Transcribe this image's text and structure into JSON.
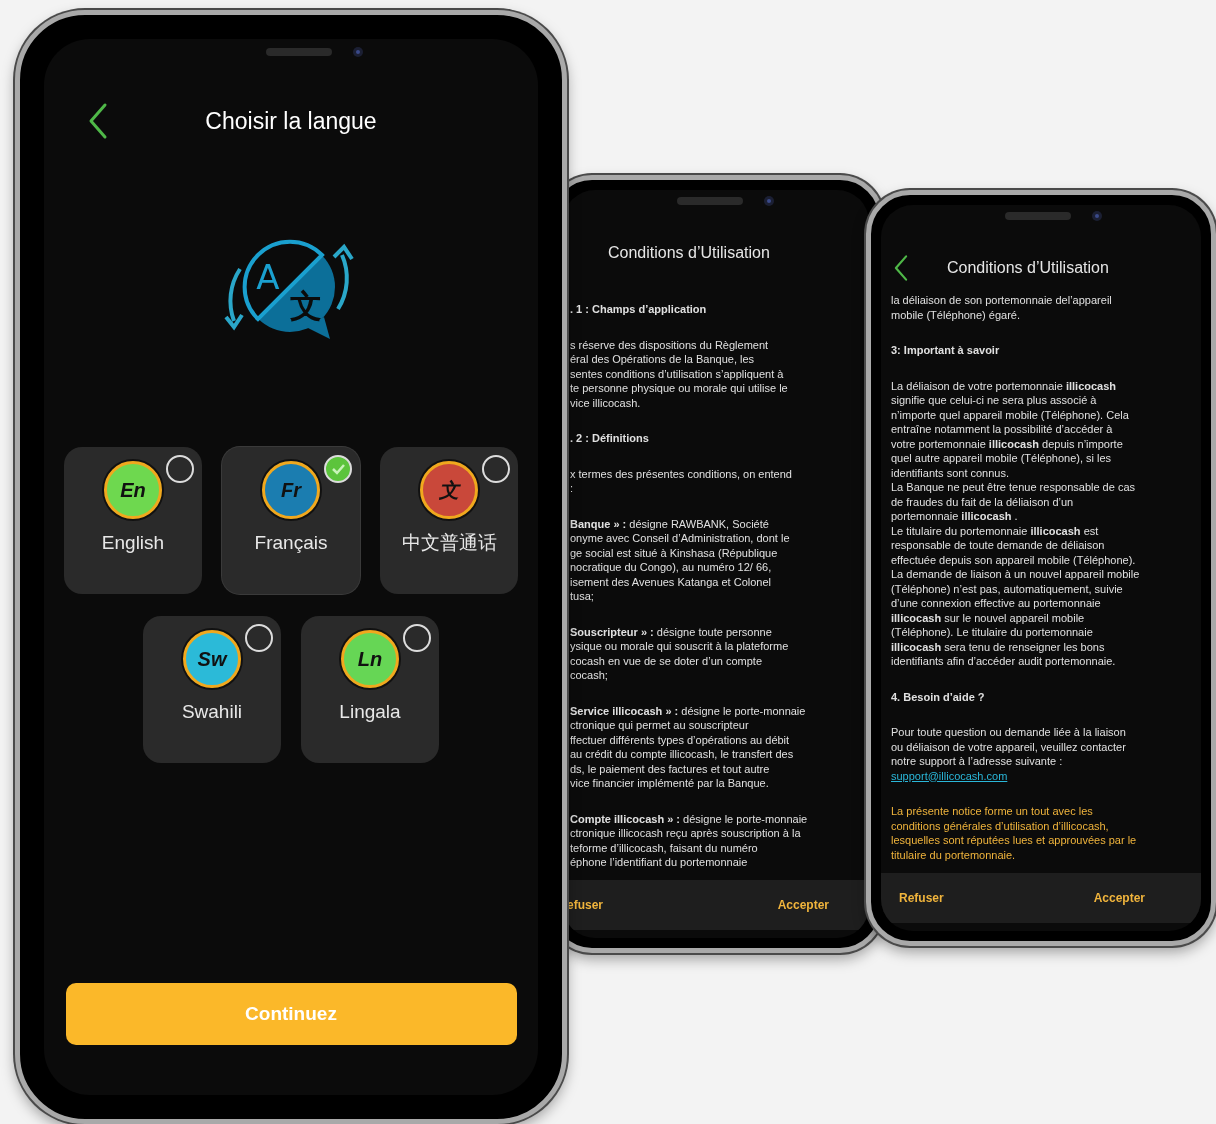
{
  "phones": [
    {
      "kind": "language_picker",
      "title": "Choisir la langue",
      "back_button": true,
      "icon_glyphs": [
        "A",
        "文"
      ],
      "languages": [
        {
          "badge": "En",
          "label": "English",
          "color": "#6ed84f",
          "selected": false
        },
        {
          "badge": "Fr",
          "label": "Français",
          "color": "#1b7db0",
          "selected": true
        },
        {
          "badge": "文",
          "label": "中文普通话",
          "color": "#c9483a",
          "selected": false
        },
        {
          "badge": "Sw",
          "label": "Swahili",
          "color": "#2bbad8",
          "selected": false
        },
        {
          "badge": "Ln",
          "label": "Lingala",
          "color": "#66d655",
          "selected": false
        }
      ],
      "continue_button": "Continuez"
    },
    {
      "kind": "terms",
      "title": "Conditions d’Utilisation",
      "back_button": false,
      "blocks": [
        {
          "kind": "heading",
          "lines": [
            ". 1 : Champs d’application"
          ]
        },
        {
          "kind": "paragraph",
          "lines": [
            "s réserve des dispositions du Règlement",
            "éral des Opérations de la Banque, les",
            "sentes conditions d’utilisation s’appliquent à",
            "te personne physique ou morale qui utilise le",
            "vice illicocash."
          ]
        },
        {
          "kind": "heading",
          "lines": [
            ". 2 : Définitions"
          ]
        },
        {
          "kind": "paragraph",
          "lines": [
            "x termes des présentes conditions, on entend",
            ":"
          ]
        },
        {
          "kind": "paragraph",
          "lines": [
            "**Banque » :** désigne RAWBANK, Société",
            "onyme avec Conseil d’Administration, dont le",
            "ge social est situé à Kinshasa (République",
            "nocratique du Congo), au numéro 12/ 66,",
            "isement des Avenues Katanga et Colonel",
            "tusa;"
          ]
        },
        {
          "kind": "paragraph",
          "lines": [
            "**Souscripteur » :** désigne toute personne",
            "ysique ou morale qui souscrit à la plateforme",
            "cocash en vue de se doter d’un compte",
            "cocash;"
          ]
        },
        {
          "kind": "paragraph",
          "lines": [
            "**Service illicocash » :** désigne le porte-monnaie",
            "ctronique qui permet au souscripteur",
            "ffectuer différents types d’opérations au débit",
            "au crédit du compte illicocash, le transfert des",
            "ds, le paiement des factures et tout autre",
            "vice financier implémenté par la Banque."
          ]
        },
        {
          "kind": "paragraph",
          "lines": [
            "**Compte illicocash » :** désigne le porte-monnaie",
            "ctronique illicocash reçu après souscription à la",
            "teforme d’illicocash, faisant du numéro",
            "éphone l’identifiant du portemonnaie"
          ]
        }
      ],
      "refuse_button": "efuser",
      "accept_button": "Accepter"
    },
    {
      "kind": "terms",
      "title": "Conditions d’Utilisation",
      "back_button": true,
      "blocks": [
        {
          "kind": "paragraph",
          "lines": [
            "la déliaison de son portemonnaie del’appareil",
            "mobile (Téléphone) égaré."
          ]
        },
        {
          "kind": "heading",
          "lines": [
            "3: Important à savoir"
          ]
        },
        {
          "kind": "paragraph",
          "lines": [
            "La déliaison de votre portemonnaie **illicocash**",
            "signifie que celui-ci ne sera plus associé à",
            "n’importe quel appareil mobile (Téléphone). Cela",
            "entraîne notamment la possibilité d’accéder à",
            "votre portemonnaie **illicocash** depuis n’importe",
            "quel autre appareil mobile (Téléphone), si les",
            "identifiants sont connus.",
            "La Banque ne peut être tenue responsable de cas",
            "de fraudes du fait de la déliaison d’un",
            "portemonnaie **illicocash** .",
            "Le titulaire du portemonnaie **illicocash** est",
            "responsable de toute demande de déliaison",
            "effectuée depuis son appareil mobile (Téléphone).",
            "La demande de liaison à un nouvel appareil mobile",
            "(Téléphone) n’est pas, automatiquement, suivie",
            "d’une connexion effective au portemonnaie",
            "**illicocash** sur le nouvel appareil mobile",
            "(Téléphone). Le titulaire du portemonnaie",
            "**illicocash** sera tenu de renseigner les bons",
            "identifiants afin d’accéder audit portemonnaie."
          ]
        },
        {
          "kind": "heading",
          "lines": [
            "4. Besoin d’aide ?"
          ]
        },
        {
          "kind": "paragraph",
          "lines": [
            "Pour toute question ou demande liée à la liaison",
            "ou déliaison de votre appareil, veuillez contacter",
            "notre support à l’adresse suivante :"
          ]
        },
        {
          "kind": "link",
          "lines": [
            "support@illicocash.com"
          ]
        },
        {
          "kind": "notice",
          "lines": [
            "La présente notice forme un tout avec les",
            "conditions générales d’utilisation d’illicocash,",
            "lesquelles sont réputées lues et approuvées par le",
            "titulaire du portemonnaie."
          ]
        }
      ],
      "refuse_button": "Refuser",
      "accept_button": "Accepter"
    }
  ]
}
